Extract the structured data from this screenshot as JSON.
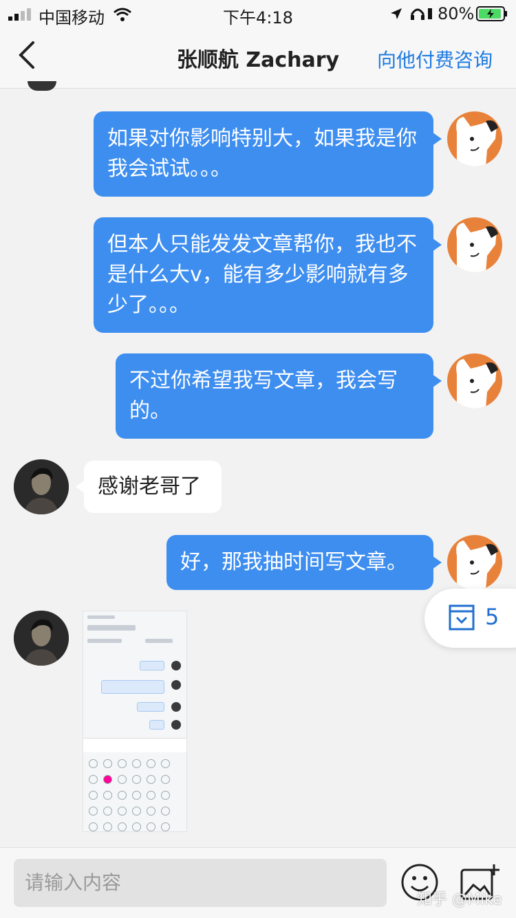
{
  "status_bar": {
    "carrier": "中国移动",
    "time": "下午4:18",
    "battery": "80%"
  },
  "nav": {
    "title": "张顺航 Zachary",
    "action": "向他付费咨询"
  },
  "messages": [
    {
      "from": "me",
      "text": "如果对你影响特别大，如果我是你我会试试。。。"
    },
    {
      "from": "me",
      "text": "但本人只能发发文章帮你，我也不是什么大v，能有多少影响就有多少了。。。"
    },
    {
      "from": "me",
      "text": "不过你希望我写文章，我会写的。"
    },
    {
      "from": "them",
      "text": "感谢老哥了"
    },
    {
      "from": "me",
      "text": "好，那我抽时间写文章。"
    },
    {
      "from": "them",
      "type": "image"
    }
  ],
  "folder_pill": {
    "count": "5"
  },
  "input": {
    "placeholder": "请输入内容"
  },
  "watermark": "知乎 @Mike",
  "colors": {
    "accent": "#1f7be0",
    "bubble_out": "#3e8ef0",
    "avatar_dog": "#e8823a"
  }
}
